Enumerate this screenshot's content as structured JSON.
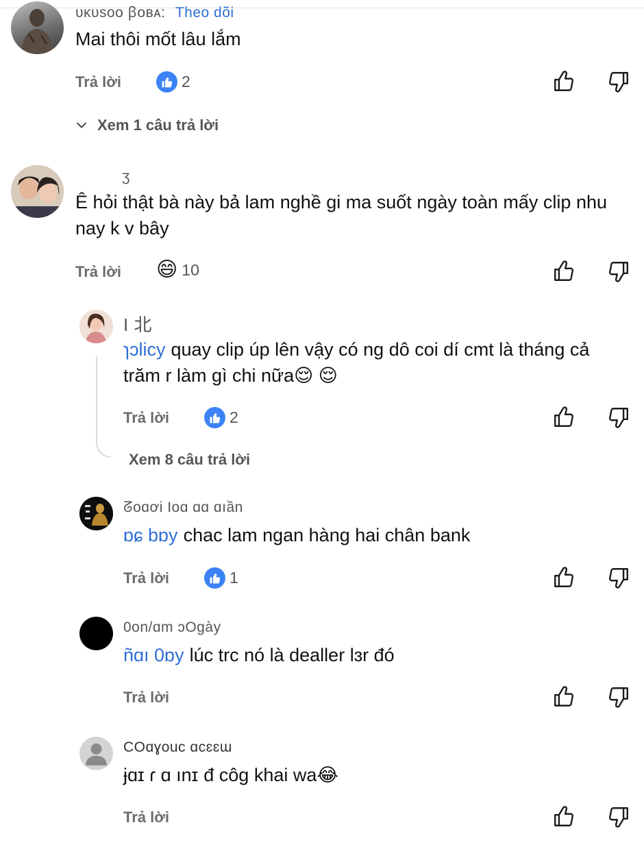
{
  "comments": [
    {
      "author": "ᴜᴋᴜѕᴏᴏ ꞵᴏʙᴀ:",
      "follow": "Theo dõi",
      "text": "Mai thôi mốt lâu lắm",
      "reply": "Trả lời",
      "reaction": {
        "type": "like",
        "count": "2"
      },
      "view_replies": "Xem 1 câu trả lời"
    },
    {
      "author": "ʒ",
      "text": "Ê hỏi thật bà này bả lam nghề gi ma suốt ngày toàn mấy clip nhu nay k v bây",
      "reply": "Trả lời",
      "reaction": {
        "type": "haha",
        "count": "10"
      }
    },
    {
      "author": "I 北",
      "mention": "ɿɔlicy",
      "text": "quay clip úp lên vậy có ng dô coi dí cmt là tháng cả trăm r làm gì chi nữa😌 😌",
      "reply": "Trả lời",
      "reaction": {
        "type": "like",
        "count": "2"
      },
      "view_replies": "Xem 8 câu trả lời"
    },
    {
      "author": "ᘔoɑơi Ioɑ ɑɑ ɑıần",
      "mention": "ɒɕ bɒy",
      "text": "chac lam ngan hàng hai chân bank",
      "reply": "Trả lời",
      "reaction": {
        "type": "like",
        "count": "1"
      }
    },
    {
      "author": "0on/ɑm ɔOgày",
      "mention": "ñɑı 0ɒy",
      "text": "lúc trc nó là dealler lɜr đó",
      "reply": "Trả lời"
    },
    {
      "author": "COɑɣouc ɑcɛɛɯ",
      "mention": "ɉɑɪ ɾ ɑ ınɪ",
      "text": "đ côg khai wa😂",
      "reply": "Trả lời"
    }
  ],
  "icons": {
    "like": "thumbs-up-outline-icon",
    "dislike": "thumbs-down-outline-icon",
    "chevron": "chevron-down-icon",
    "like_badge": "like-badge-icon",
    "haha_badge": "grinning-face-icon"
  },
  "colors": {
    "link": "#2f6fd4",
    "like_badge": "#3b82f6",
    "muted": "#6b6b6b"
  }
}
